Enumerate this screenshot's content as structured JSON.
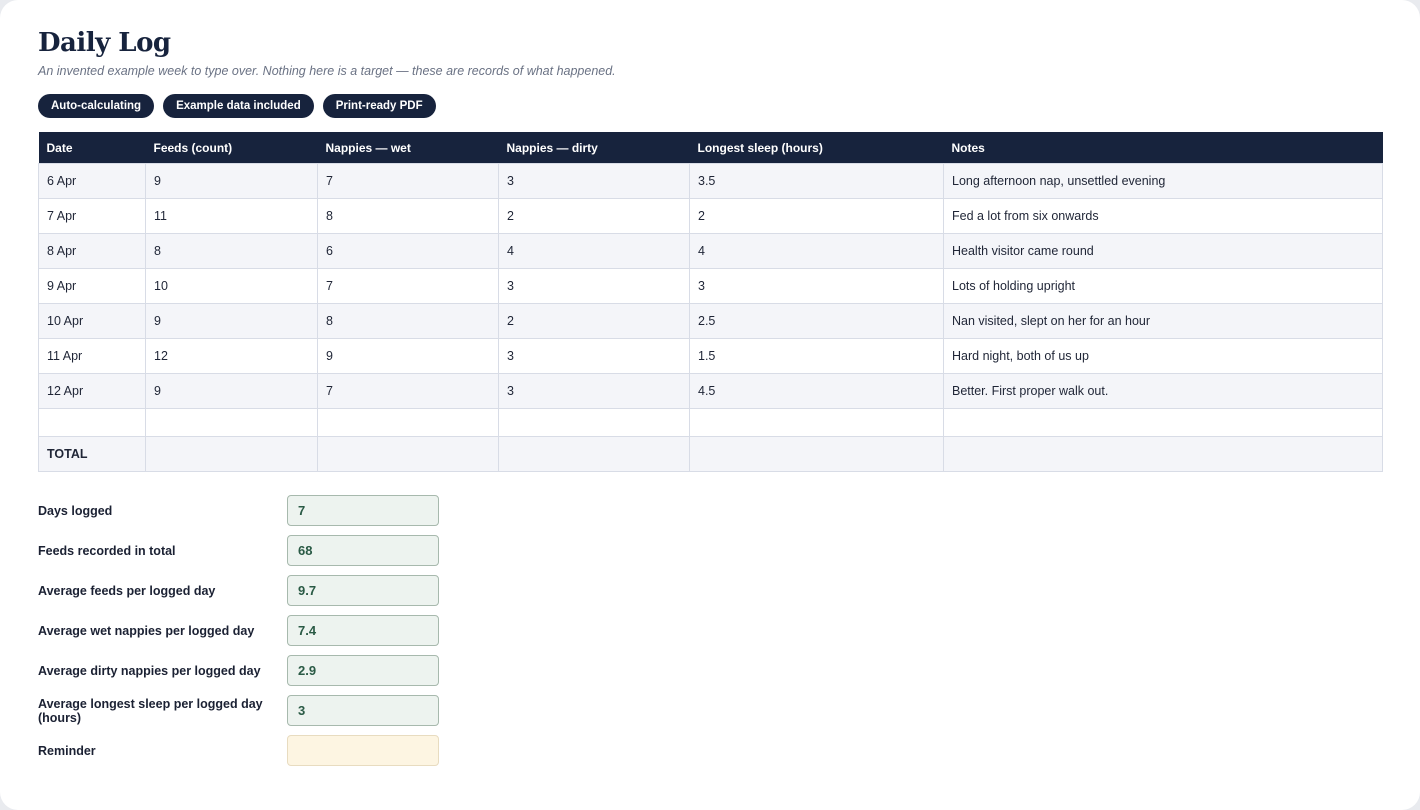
{
  "page": {
    "title": "Daily Log",
    "subtitle": "An invented example week to type over. Nothing here is a target — these are records of what happened."
  },
  "badges": [
    "Auto-calculating",
    "Example data included",
    "Print-ready PDF"
  ],
  "table": {
    "headers": [
      "Date",
      "Feeds (count)",
      "Nappies — wet",
      "Nappies — dirty",
      "Longest sleep (hours)",
      "Notes"
    ],
    "rows": [
      [
        "6 Apr",
        "9",
        "7",
        "3",
        "3.5",
        "Long afternoon nap, unsettled evening"
      ],
      [
        "7 Apr",
        "11",
        "8",
        "2",
        "2",
        "Fed a lot from six onwards"
      ],
      [
        "8 Apr",
        "8",
        "6",
        "4",
        "4",
        "Health visitor came round"
      ],
      [
        "9 Apr",
        "10",
        "7",
        "3",
        "3",
        "Lots of holding upright"
      ],
      [
        "10 Apr",
        "9",
        "8",
        "2",
        "2.5",
        "Nan visited, slept on her for an hour"
      ],
      [
        "11 Apr",
        "12",
        "9",
        "3",
        "1.5",
        "Hard night, both of us up"
      ],
      [
        "12 Apr",
        "9",
        "7",
        "3",
        "4.5",
        "Better. First proper walk out."
      ]
    ],
    "total_label": "TOTAL"
  },
  "summary": [
    {
      "label": "Days logged",
      "value": "7"
    },
    {
      "label": "Feeds recorded in total",
      "value": "68"
    },
    {
      "label": "Average feeds per logged day",
      "value": "9.7"
    },
    {
      "label": "Average wet nappies per logged day",
      "value": "7.4"
    },
    {
      "label": "Average dirty nappies per logged day",
      "value": "2.9"
    },
    {
      "label": "Average longest sleep per logged day (hours)",
      "value": "3"
    },
    {
      "label": "Reminder",
      "value": ""
    }
  ],
  "colors": {
    "navy": "#17233d",
    "summary_fill": "#edf3ef",
    "reminder_fill": "#fdf5e2"
  }
}
